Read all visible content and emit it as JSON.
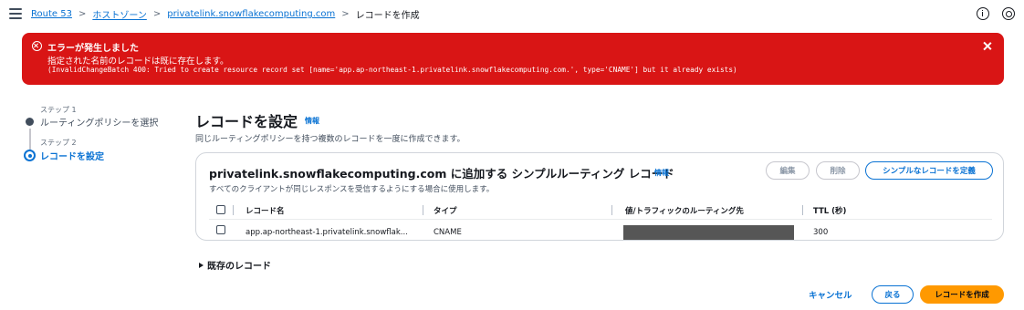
{
  "breadcrumb": {
    "items": [
      "Route 53",
      "ホストゾーン",
      "privatelink.snowflakecomputing.com"
    ],
    "current": "レコードを作成"
  },
  "error": {
    "title": "エラーが発生しました",
    "message": "指定された名前のレコードは既に存在します。",
    "detail": "(InvalidChangeBatch 400: Tried to create resource record set [name='app.ap-northeast-1.privatelink.snowflakecomputing.com.', type='CNAME'] but it already exists)"
  },
  "steps": [
    {
      "label": "ステップ 1",
      "name": "ルーティングポリシーを選択"
    },
    {
      "label": "ステップ 2",
      "name": "レコードを設定"
    }
  ],
  "page": {
    "title": "レコードを設定",
    "info": "情報",
    "description": "同じルーティングポリシーを持つ複数のレコードを一度に作成できます。"
  },
  "container": {
    "title": "privatelink.snowflakecomputing.com に追加する シンプルルーティング レコード",
    "info": "情報",
    "description": "すべてのクライアントが同じレスポンスを受信するようにする場合に使用します。",
    "edit_label": "編集",
    "delete_label": "削除",
    "define_label": "シンプルなレコードを定義"
  },
  "table": {
    "columns": [
      "レコード名",
      "タイプ",
      "値/トラフィックのルーティング先",
      "TTL (秒)"
    ],
    "rows": [
      {
        "name": "app.ap-northeast-1.privatelink.snowflak...",
        "type": "CNAME",
        "ttl": "300"
      }
    ]
  },
  "existing_records": "既存のレコード",
  "footer": {
    "cancel": "キャンセル",
    "back": "戻る",
    "create": "レコードを作成"
  },
  "colors": {
    "error_bg": "#d91515",
    "link": "#0972d3",
    "primary": "#ff9900"
  }
}
